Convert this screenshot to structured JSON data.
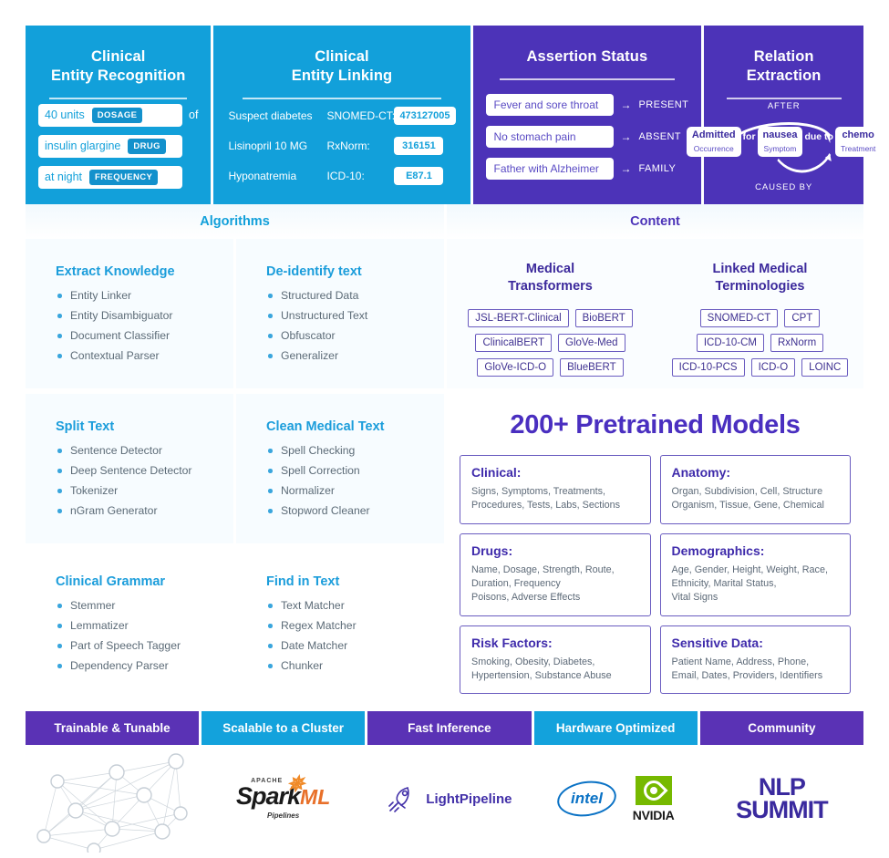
{
  "hero": [
    {
      "id": "clinical-entity-recognition",
      "title": "Clinical\nEntity Recognition",
      "theme": "blue",
      "rows": [
        {
          "text": "40 units",
          "tag": "DOSAGE",
          "after": "of"
        },
        {
          "text": "insulin glargine",
          "tag": "DRUG",
          "after": ""
        },
        {
          "text": "at night",
          "tag": "FREQUENCY",
          "after": ""
        }
      ]
    },
    {
      "id": "clinical-entity-linking",
      "title": "Clinical\nEntity Linking",
      "theme": "blue",
      "rows": [
        {
          "term": "Suspect diabetes",
          "ontology": "SNOMED-CT:",
          "code": "473127005"
        },
        {
          "term": "Lisinopril  10 MG",
          "ontology": "RxNorm:",
          "code": "316151"
        },
        {
          "term": "Hyponatremia",
          "ontology": "ICD-10:",
          "code": "E87.1"
        }
      ]
    },
    {
      "id": "assertion-status",
      "title": "Assertion Status",
      "theme": "purple",
      "rows": [
        {
          "text": "Fever and sore throat",
          "arrow": "→",
          "label": "PRESENT"
        },
        {
          "text": "No stomach pain",
          "arrow": "→",
          "label": "ABSENT"
        },
        {
          "text": "Father with Alzheimer",
          "arrow": "→",
          "label": "FAMILY"
        }
      ]
    },
    {
      "id": "relation-extraction",
      "title": "Relation Extraction",
      "theme": "purple",
      "top_label": "AFTER",
      "bottom_label": "CAUSED BY",
      "nodes": [
        {
          "main": "Admitted",
          "sub": "Occurrence"
        },
        {
          "main": "nausea",
          "sub": "Symptom"
        },
        {
          "main": "chemo",
          "sub": "Treatment"
        }
      ],
      "connectors": [
        "for",
        "due to"
      ]
    }
  ],
  "bands": {
    "algorithms": "Algorithms",
    "content": "Content"
  },
  "algorithms": [
    {
      "title": "Extract Knowledge",
      "items": [
        "Entity Linker",
        "Entity Disambiguator",
        "Document Classifier",
        "Contextual Parser"
      ]
    },
    {
      "title": "De-identify text",
      "items": [
        "Structured Data",
        "Unstructured Text",
        "Obfuscator",
        "Generalizer"
      ]
    },
    {
      "title": "Split Text",
      "items": [
        "Sentence Detector",
        "Deep Sentence Detector",
        "Tokenizer",
        "nGram Generator"
      ]
    },
    {
      "title": "Clean Medical Text",
      "items": [
        "Spell Checking",
        "Spell Correction",
        "Normalizer",
        "Stopword Cleaner"
      ]
    },
    {
      "title": "Clinical Grammar",
      "items": [
        "Stemmer",
        "Lemmatizer",
        "Part of Speech Tagger",
        "Dependency Parser"
      ]
    },
    {
      "title": "Find in Text",
      "items": [
        "Text Matcher",
        "Regex Matcher",
        "Date Matcher",
        "Chunker"
      ]
    }
  ],
  "content_top": [
    {
      "title": "Medical\nTransformers",
      "tag_rows": [
        [
          "JSL-BERT-Clinical",
          "BioBERT"
        ],
        [
          "ClinicalBERT",
          "GloVe-Med"
        ],
        [
          "GloVe-ICD-O",
          "BlueBERT"
        ]
      ]
    },
    {
      "title": "Linked Medical\nTerminologies",
      "tag_rows": [
        [
          "SNOMED-CT",
          "CPT"
        ],
        [
          "ICD-10-CM",
          "RxNorm"
        ],
        [
          "ICD-10-PCS",
          "ICD-O",
          "LOINC"
        ]
      ]
    }
  ],
  "models": {
    "title": "200+ Pretrained Models",
    "cards": [
      {
        "head": "Clinical:",
        "body": "Signs, Symptoms, Treatments,\nProcedures, Tests, Labs, Sections"
      },
      {
        "head": "Anatomy:",
        "body": "Organ, Subdivision, Cell, Structure\nOrganism, Tissue, Gene, Chemical"
      },
      {
        "head": "Drugs:",
        "body": "Name, Dosage, Strength, Route,\nDuration, Frequency\nPoisons, Adverse Effects"
      },
      {
        "head": "Demographics:",
        "body": "Age, Gender, Height, Weight, Race,\nEthnicity, Marital Status,\nVital Signs"
      },
      {
        "head": "Risk Factors:",
        "body": "Smoking, Obesity, Diabetes,\nHypertension, Substance Abuse"
      },
      {
        "head": "Sensitive Data:",
        "body": "Patient Name, Address, Phone,\nEmail, Dates, Providers, Identifiers"
      }
    ]
  },
  "footer": [
    {
      "title": "Trainable & Tunable",
      "theme": "purple",
      "logo": "network-graph"
    },
    {
      "title": "Scalable to a Cluster",
      "theme": "blue",
      "logo": "apache-spark-ml",
      "logo_text": {
        "apache": "APACHE",
        "spark": "Spark",
        "ml": "ML",
        "pipelines": "Pipelines"
      }
    },
    {
      "title": "Fast Inference",
      "theme": "purple",
      "logo": "lightpipeline",
      "logo_text": {
        "name": "LightPipeline"
      }
    },
    {
      "title": "Hardware Optimized",
      "theme": "blue",
      "logo": "intel-nvidia",
      "logo_text": {
        "intel": "intel",
        "nvidia": "NVIDIA"
      }
    },
    {
      "title": "Community",
      "theme": "purple",
      "logo": "nlp-summit",
      "logo_text": {
        "line1": "NLP",
        "line2": "SUMMIT"
      }
    }
  ],
  "colors": {
    "blue": "#12a0da",
    "purple": "#4c33b8",
    "footer_purple": "#5a32b5",
    "body_text": "#5c6b77"
  }
}
